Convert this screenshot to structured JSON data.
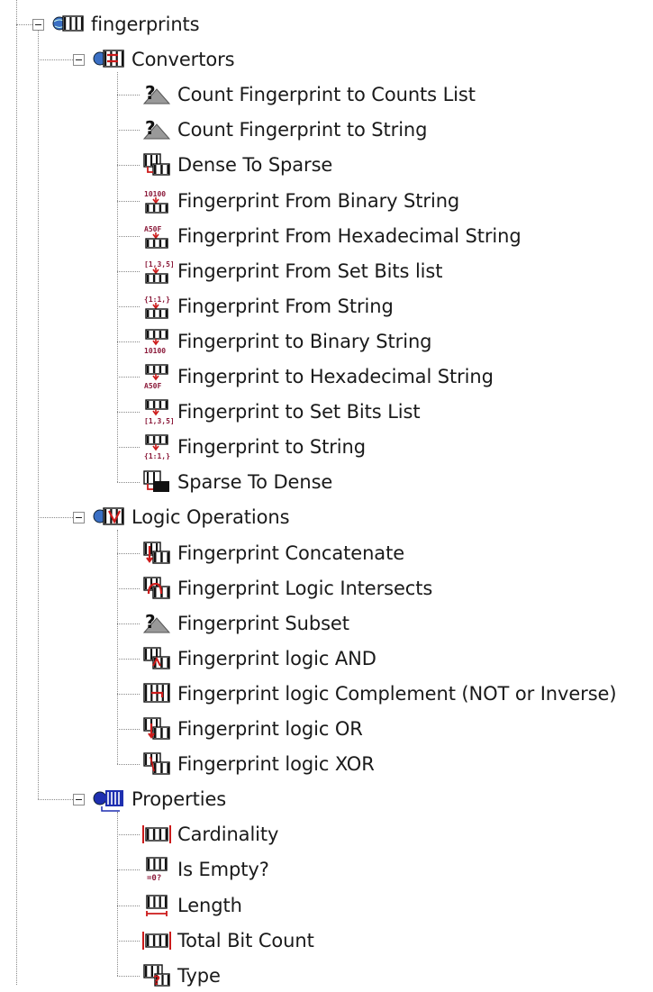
{
  "tree": {
    "root": {
      "label": "fingerprints",
      "icon": "fingerprint-barcode-globe-icon",
      "expanded": true
    },
    "categories": [
      {
        "label": "Convertors",
        "icon": "convertors-category-icon",
        "expanded": true,
        "items": [
          {
            "label": "Count Fingerprint to Counts List",
            "icon": "question-wizard-icon"
          },
          {
            "label": "Count Fingerprint to String",
            "icon": "question-wizard-icon"
          },
          {
            "label": "Dense To Sparse",
            "icon": "dense-to-sparse-icon"
          },
          {
            "label": "Fingerprint From Binary String",
            "icon": "binary-to-fingerprint-icon",
            "glyph": "10100"
          },
          {
            "label": "Fingerprint From Hexadecimal String",
            "icon": "hex-to-fingerprint-icon",
            "glyph": "A50F"
          },
          {
            "label": "Fingerprint From Set Bits list",
            "icon": "setbits-to-fingerprint-icon",
            "glyph": "[1,3,5]"
          },
          {
            "label": "Fingerprint From String",
            "icon": "string-to-fingerprint-icon",
            "glyph": "{1:1,}"
          },
          {
            "label": "Fingerprint to Binary String",
            "icon": "fingerprint-to-binary-icon",
            "glyph": "10100"
          },
          {
            "label": "Fingerprint to Hexadecimal String",
            "icon": "fingerprint-to-hex-icon",
            "glyph": "A50F"
          },
          {
            "label": "Fingerprint to Set Bits List",
            "icon": "fingerprint-to-setbits-icon",
            "glyph": "[1,3,5]"
          },
          {
            "label": "Fingerprint to String",
            "icon": "fingerprint-to-string-icon",
            "glyph": "{1:1,}"
          },
          {
            "label": "Sparse To Dense",
            "icon": "sparse-to-dense-icon"
          }
        ]
      },
      {
        "label": "Logic Operations",
        "icon": "logic-operations-category-icon",
        "expanded": true,
        "items": [
          {
            "label": "Fingerprint Concatenate",
            "icon": "concatenate-icon"
          },
          {
            "label": "Fingerprint Logic Intersects",
            "icon": "intersects-icon"
          },
          {
            "label": "Fingerprint Subset",
            "icon": "question-wizard-icon"
          },
          {
            "label": "Fingerprint logic AND",
            "icon": "logic-and-icon"
          },
          {
            "label": "Fingerprint logic Complement (NOT or Inverse)",
            "icon": "logic-not-icon"
          },
          {
            "label": "Fingerprint logic OR",
            "icon": "logic-or-icon"
          },
          {
            "label": "Fingerprint logic XOR",
            "icon": "logic-xor-icon"
          }
        ]
      },
      {
        "label": "Properties",
        "icon": "properties-category-icon",
        "expanded": true,
        "items": [
          {
            "label": "Cardinality",
            "icon": "cardinality-icon"
          },
          {
            "label": "Is Empty?",
            "icon": "is-empty-icon",
            "glyph": "=0?"
          },
          {
            "label": "Length",
            "icon": "length-icon"
          },
          {
            "label": "Total Bit Count",
            "icon": "total-bit-count-icon"
          },
          {
            "label": "Type",
            "icon": "type-icon"
          }
        ]
      }
    ]
  },
  "colors": {
    "accent_red": "#cc1a1a",
    "glyph_maroon": "#8b1a3a",
    "blue": "#1e2fb0",
    "line": "#8a8a8a",
    "text": "#1a1a1a"
  }
}
